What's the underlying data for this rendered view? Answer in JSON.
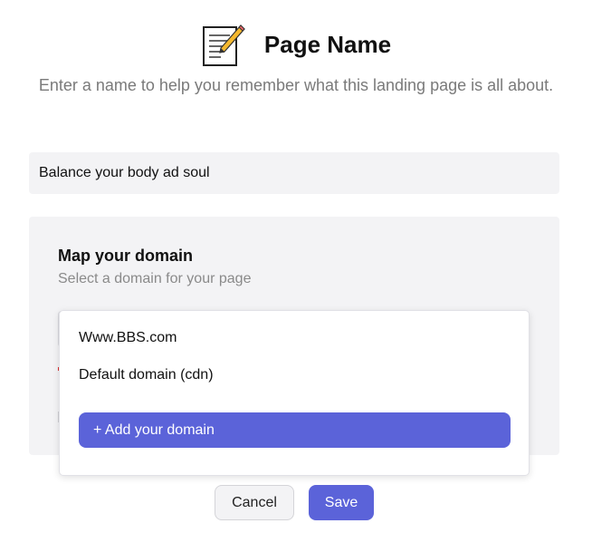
{
  "header": {
    "icon": "memo-pencil-icon",
    "title": "Page Name",
    "subtitle": "Enter a name to help you remember what this landing page is all about."
  },
  "page_name_input": {
    "value": "Balance your body ad soul"
  },
  "domain_section": {
    "title": "Map your domain",
    "subtitle": "Select a domain for your page",
    "dropdown": {
      "options": [
        "Www.BBS.com",
        "Default domain (cdn)"
      ],
      "add_domain_label": "+ Add your domain"
    }
  },
  "footer": {
    "cancel_label": "Cancel",
    "save_label": "Save"
  },
  "colors": {
    "accent": "#5b63d9",
    "panel_bg": "#f3f3f5"
  }
}
